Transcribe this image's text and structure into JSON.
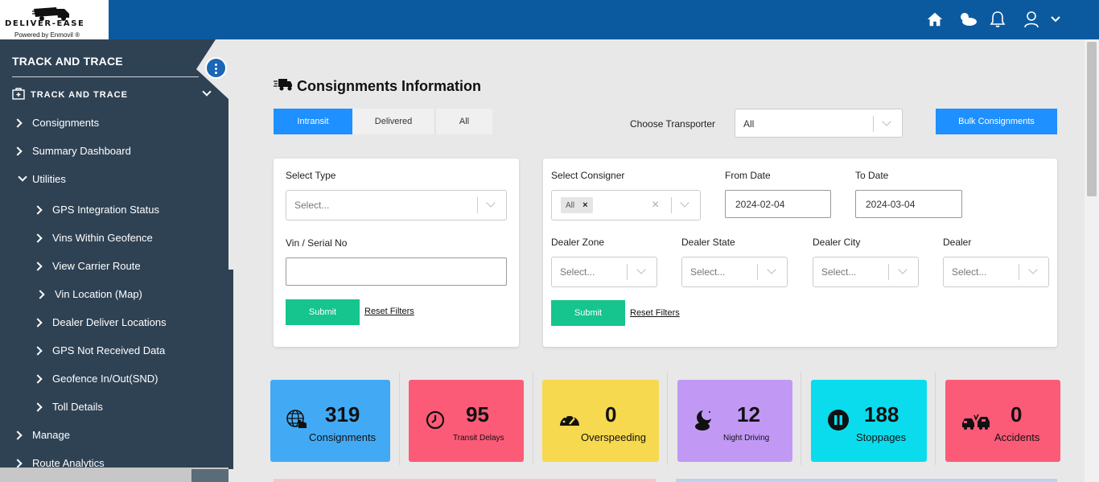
{
  "brand": {
    "name": "DELIVER-EASE",
    "powered_by": "Powered by Enmovil ®"
  },
  "topbar": {
    "icons": [
      "home-icon",
      "weather-icon",
      "bell-icon",
      "user-icon",
      "chevron-down-icon"
    ]
  },
  "sidebar": {
    "title": "TRACK AND TRACE",
    "section": "TRACK AND TRACE",
    "items": [
      {
        "label": "Consignments"
      },
      {
        "label": "Summary Dashboard"
      },
      {
        "label": "Utilities"
      },
      {
        "label": "GPS Integration Status"
      },
      {
        "label": "Vins Within Geofence"
      },
      {
        "label": "View Carrier Route"
      },
      {
        "label": "Vin Location (Map)"
      },
      {
        "label": "Dealer Deliver Locations"
      },
      {
        "label": "GPS Not Received Data"
      },
      {
        "label": "Geofence In/Out(SND)"
      },
      {
        "label": "Toll Details"
      },
      {
        "label": "Manage"
      },
      {
        "label": "Route Analytics"
      }
    ]
  },
  "page": {
    "title": "Consignments Information",
    "tabs": [
      {
        "label": "Intransit"
      },
      {
        "label": "Delivered"
      },
      {
        "label": "All"
      }
    ],
    "transporter": {
      "label": "Choose Transporter",
      "value": "All"
    },
    "bulk_button": "Bulk Consignments"
  },
  "filters_left": {
    "type_label": "Select Type",
    "type_placeholder": "Select...",
    "vin_label": "Vin / Serial No",
    "vin_value": "",
    "submit": "Submit",
    "reset": "Reset Filters"
  },
  "filters_right": {
    "consigner_label": "Select Consigner",
    "consigner_tag": "All",
    "from_label": "From Date",
    "from_value": "2024-02-04",
    "to_label": "To Date",
    "to_value": "2024-03-04",
    "zone_label": "Dealer Zone",
    "state_label": "Dealer State",
    "city_label": "Dealer City",
    "dealer_label": "Dealer",
    "placeholder": "Select...",
    "submit": "Submit",
    "reset": "Reset Filters"
  },
  "cards": [
    {
      "value": "319",
      "label": "Consignments",
      "color": "#42aaf5",
      "icon": "globe-hand-icon"
    },
    {
      "value": "95",
      "label": "Transit Delays",
      "color": "#fb5b77",
      "icon": "clock-icon"
    },
    {
      "value": "0",
      "label": "Overspeeding",
      "color": "#f6d94e",
      "icon": "speedometer-icon"
    },
    {
      "value": "12",
      "label": "Night Driving",
      "color": "#c199f5",
      "icon": "moon-cloud-icon"
    },
    {
      "value": "188",
      "label": "Stoppages",
      "color": "#0bdced",
      "icon": "pause-icon"
    },
    {
      "value": "0",
      "label": "Accidents",
      "color": "#fb5b77",
      "icon": "car-crash-icon"
    }
  ]
}
